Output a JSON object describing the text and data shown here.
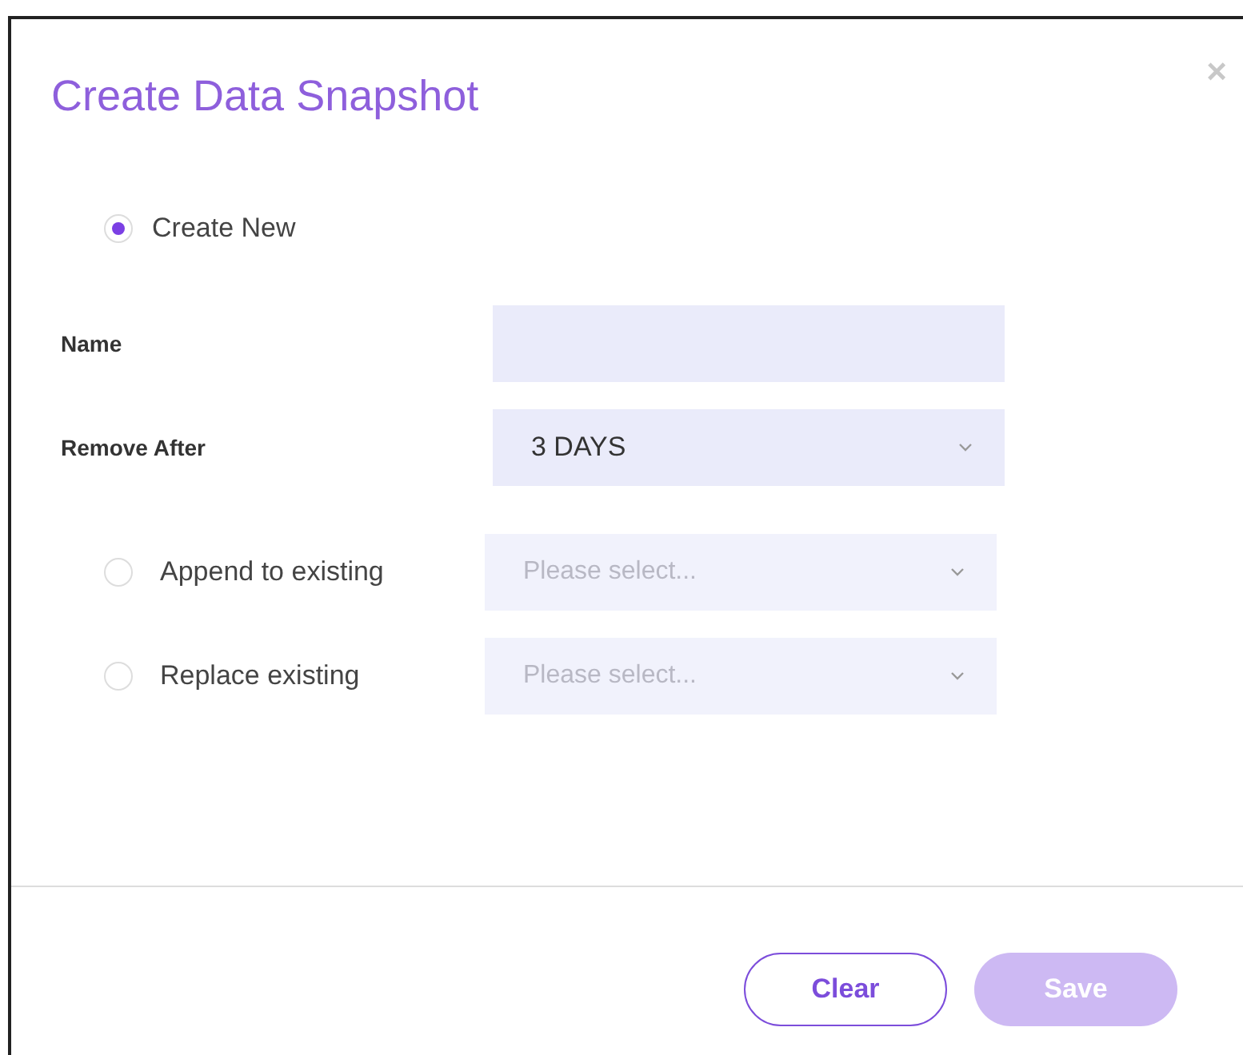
{
  "dialog": {
    "title": "Create Data Snapshot",
    "close": "×"
  },
  "create_new": {
    "label": "Create New",
    "selected": true
  },
  "fields": [
    {
      "label": "Name"
    },
    {
      "label": "Remove After",
      "value": "3 DAYS"
    }
  ],
  "existing_options": [
    {
      "label": "Append to existing",
      "selected": false,
      "placeholder": "Please select..."
    },
    {
      "label": "Replace existing",
      "selected": false,
      "placeholder": "Please select..."
    }
  ],
  "buttons": [
    {
      "label": "Clear",
      "kind": "outline",
      "disabled": false
    },
    {
      "label": "Save",
      "kind": "primary",
      "disabled": true
    }
  ]
}
